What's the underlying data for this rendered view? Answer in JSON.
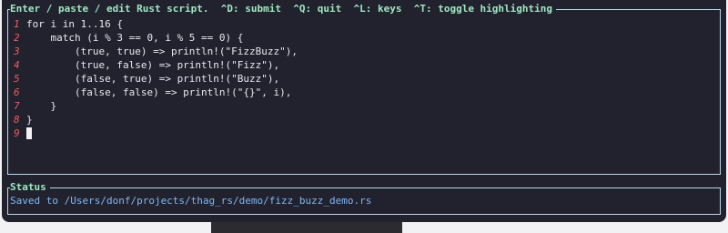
{
  "editor": {
    "title": "Enter / paste / edit Rust script.  ^D: submit  ^Q: quit  ^L: keys  ^T: toggle highlighting",
    "lines": [
      {
        "number": "1",
        "code": "for i in 1..16 {"
      },
      {
        "number": "2",
        "code": "    match (i % 3 == 0, i % 5 == 0) {"
      },
      {
        "number": "3",
        "code": "        (true, true) => println!(\"FizzBuzz\"),"
      },
      {
        "number": "4",
        "code": "        (true, false) => println!(\"Fizz\"),"
      },
      {
        "number": "5",
        "code": "        (false, true) => println!(\"Buzz\"),"
      },
      {
        "number": "6",
        "code": "        (false, false) => println!(\"{}\", i),"
      },
      {
        "number": "7",
        "code": "    }"
      },
      {
        "number": "8",
        "code": "}"
      },
      {
        "number": "9",
        "code": ""
      }
    ]
  },
  "status": {
    "title": "Status",
    "message": "Saved to /Users/donf/projects/thag_rs/demo/fizz_buzz_demo.rs"
  },
  "colors": {
    "background": "#22222f",
    "border": "#b9d8ef",
    "title": "#9ee7c1",
    "line_number": "#f05a5a",
    "code_text": "#e8e8ee",
    "status_text": "#7eb8f5"
  }
}
